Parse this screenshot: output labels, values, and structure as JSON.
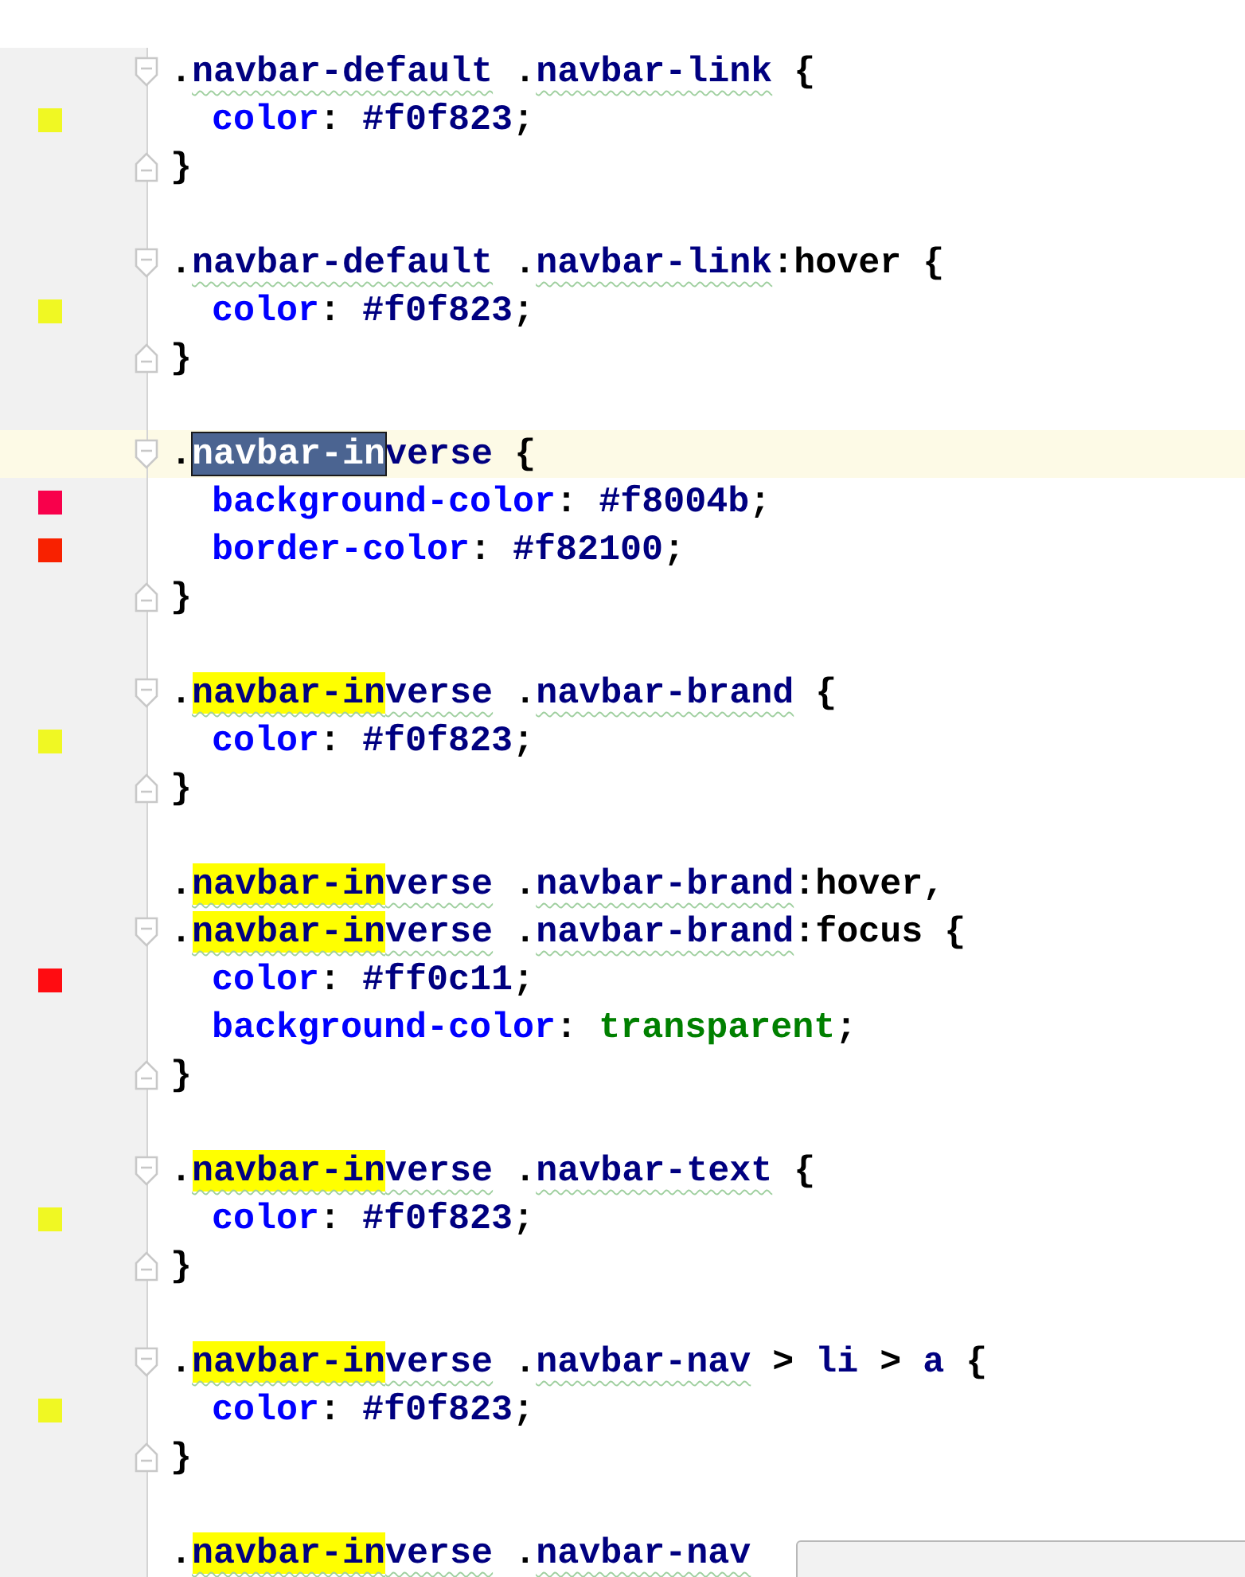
{
  "editor": {
    "lines": [
      {
        "current": false,
        "kind": "open",
        "tokens": [
          {
            "text": ".",
            "kind": "punct"
          },
          {
            "text": "navbar-default",
            "kind": "selector",
            "underlined": true
          },
          {
            "text": " .",
            "kind": "punct"
          },
          {
            "text": "navbar-link",
            "kind": "selector",
            "underlined": true
          },
          {
            "text": " {",
            "kind": "punct"
          }
        ]
      },
      {
        "current": false,
        "kind": "body",
        "color": "#f0f823",
        "indent": true,
        "tokens": [
          {
            "text": "color",
            "kind": "property"
          },
          {
            "text": ": ",
            "kind": "punct"
          },
          {
            "text": "#f0f823",
            "kind": "value"
          },
          {
            "text": ";",
            "kind": "punct"
          }
        ]
      },
      {
        "current": false,
        "kind": "close",
        "tokens": [
          {
            "text": "}",
            "kind": "punct"
          }
        ]
      },
      {
        "current": false,
        "kind": "blank"
      },
      {
        "current": false,
        "kind": "open",
        "tokens": [
          {
            "text": ".",
            "kind": "punct"
          },
          {
            "text": "navbar-default",
            "kind": "selector",
            "underlined": true
          },
          {
            "text": " .",
            "kind": "punct"
          },
          {
            "text": "navbar-link",
            "kind": "selector",
            "underlined": true
          },
          {
            "text": ":hover {",
            "kind": "punct"
          }
        ]
      },
      {
        "current": false,
        "kind": "body",
        "color": "#f0f823",
        "indent": true,
        "tokens": [
          {
            "text": "color",
            "kind": "property"
          },
          {
            "text": ": ",
            "kind": "punct"
          },
          {
            "text": "#f0f823",
            "kind": "value"
          },
          {
            "text": ";",
            "kind": "punct"
          }
        ]
      },
      {
        "current": false,
        "kind": "close",
        "tokens": [
          {
            "text": "}",
            "kind": "punct"
          }
        ]
      },
      {
        "current": false,
        "kind": "blank"
      },
      {
        "current": true,
        "kind": "open",
        "tokens": [
          {
            "text": ".",
            "kind": "punct"
          },
          {
            "text": "navbar-in",
            "kind": "selection"
          },
          {
            "text": "verse",
            "kind": "selector"
          },
          {
            "text": " {",
            "kind": "punct"
          }
        ]
      },
      {
        "current": false,
        "kind": "body",
        "color": "#f8004b",
        "indent": true,
        "tokens": [
          {
            "text": "background-color",
            "kind": "property"
          },
          {
            "text": ": ",
            "kind": "punct"
          },
          {
            "text": "#f8004b",
            "kind": "value"
          },
          {
            "text": ";",
            "kind": "punct"
          }
        ]
      },
      {
        "current": false,
        "kind": "body",
        "color": "#f82100",
        "indent": true,
        "tokens": [
          {
            "text": "border-color",
            "kind": "property"
          },
          {
            "text": ": ",
            "kind": "punct"
          },
          {
            "text": "#f82100",
            "kind": "value"
          },
          {
            "text": ";",
            "kind": "punct"
          }
        ]
      },
      {
        "current": false,
        "kind": "close",
        "tokens": [
          {
            "text": "}",
            "kind": "punct"
          }
        ]
      },
      {
        "current": false,
        "kind": "blank"
      },
      {
        "current": false,
        "kind": "open",
        "tokens": [
          {
            "text": ".",
            "kind": "punct"
          },
          {
            "text": "navbar-in",
            "kind": "match",
            "underlined": true
          },
          {
            "text": "verse",
            "kind": "selector",
            "underlined": true
          },
          {
            "text": " .",
            "kind": "punct"
          },
          {
            "text": "navbar-brand",
            "kind": "selector",
            "underlined": true
          },
          {
            "text": " {",
            "kind": "punct"
          }
        ]
      },
      {
        "current": false,
        "kind": "body",
        "color": "#f0f823",
        "indent": true,
        "tokens": [
          {
            "text": "color",
            "kind": "property"
          },
          {
            "text": ": ",
            "kind": "punct"
          },
          {
            "text": "#f0f823",
            "kind": "value"
          },
          {
            "text": ";",
            "kind": "punct"
          }
        ]
      },
      {
        "current": false,
        "kind": "close",
        "tokens": [
          {
            "text": "}",
            "kind": "punct"
          }
        ]
      },
      {
        "current": false,
        "kind": "blank"
      },
      {
        "current": false,
        "kind": "plain",
        "tokens": [
          {
            "text": ".",
            "kind": "punct"
          },
          {
            "text": "navbar-in",
            "kind": "match",
            "underlined": true
          },
          {
            "text": "verse",
            "kind": "selector",
            "underlined": true
          },
          {
            "text": " .",
            "kind": "punct"
          },
          {
            "text": "navbar-brand",
            "kind": "selector",
            "underlined": true
          },
          {
            "text": ":hover,",
            "kind": "punct"
          }
        ]
      },
      {
        "current": false,
        "kind": "open",
        "tokens": [
          {
            "text": ".",
            "kind": "punct"
          },
          {
            "text": "navbar-in",
            "kind": "match",
            "underlined": true
          },
          {
            "text": "verse",
            "kind": "selector",
            "underlined": true
          },
          {
            "text": " .",
            "kind": "punct"
          },
          {
            "text": "navbar-brand",
            "kind": "selector",
            "underlined": true
          },
          {
            "text": ":focus {",
            "kind": "punct"
          }
        ]
      },
      {
        "current": false,
        "kind": "body",
        "color": "#ff0c11",
        "indent": true,
        "tokens": [
          {
            "text": "color",
            "kind": "property"
          },
          {
            "text": ": ",
            "kind": "punct"
          },
          {
            "text": "#ff0c11",
            "kind": "value"
          },
          {
            "text": ";",
            "kind": "punct"
          }
        ]
      },
      {
        "current": false,
        "kind": "body",
        "indent": true,
        "tokens": [
          {
            "text": "background-color",
            "kind": "property"
          },
          {
            "text": ": ",
            "kind": "punct"
          },
          {
            "text": "transparent",
            "kind": "keyword"
          },
          {
            "text": ";",
            "kind": "punct"
          }
        ]
      },
      {
        "current": false,
        "kind": "close",
        "tokens": [
          {
            "text": "}",
            "kind": "punct"
          }
        ]
      },
      {
        "current": false,
        "kind": "blank"
      },
      {
        "current": false,
        "kind": "open",
        "tokens": [
          {
            "text": ".",
            "kind": "punct"
          },
          {
            "text": "navbar-in",
            "kind": "match",
            "underlined": true
          },
          {
            "text": "verse",
            "kind": "selector",
            "underlined": true
          },
          {
            "text": " .",
            "kind": "punct"
          },
          {
            "text": "navbar-text",
            "kind": "selector",
            "underlined": true
          },
          {
            "text": " {",
            "kind": "punct"
          }
        ]
      },
      {
        "current": false,
        "kind": "body",
        "color": "#f0f823",
        "indent": true,
        "tokens": [
          {
            "text": "color",
            "kind": "property"
          },
          {
            "text": ": ",
            "kind": "punct"
          },
          {
            "text": "#f0f823",
            "kind": "value"
          },
          {
            "text": ";",
            "kind": "punct"
          }
        ]
      },
      {
        "current": false,
        "kind": "close",
        "tokens": [
          {
            "text": "}",
            "kind": "punct"
          }
        ]
      },
      {
        "current": false,
        "kind": "blank"
      },
      {
        "current": false,
        "kind": "open",
        "tokens": [
          {
            "text": ".",
            "kind": "punct"
          },
          {
            "text": "navbar-in",
            "kind": "match",
            "underlined": true
          },
          {
            "text": "verse",
            "kind": "selector",
            "underlined": true
          },
          {
            "text": " .",
            "kind": "punct"
          },
          {
            "text": "navbar-nav",
            "kind": "selector",
            "underlined": true
          },
          {
            "text": " > ",
            "kind": "punct"
          },
          {
            "text": "li",
            "kind": "selector"
          },
          {
            "text": " > ",
            "kind": "punct"
          },
          {
            "text": "a",
            "kind": "selector"
          },
          {
            "text": " {",
            "kind": "punct"
          }
        ]
      },
      {
        "current": false,
        "kind": "body",
        "color": "#f0f823",
        "indent": true,
        "tokens": [
          {
            "text": "color",
            "kind": "property"
          },
          {
            "text": ": ",
            "kind": "punct"
          },
          {
            "text": "#f0f823",
            "kind": "value"
          },
          {
            "text": ";",
            "kind": "punct"
          }
        ]
      },
      {
        "current": false,
        "kind": "close",
        "tokens": [
          {
            "text": "}",
            "kind": "punct"
          }
        ]
      },
      {
        "current": false,
        "kind": "blank"
      },
      {
        "current": false,
        "kind": "plain",
        "tokens": [
          {
            "text": ".",
            "kind": "punct"
          },
          {
            "text": "navbar-in",
            "kind": "match",
            "underlined": true
          },
          {
            "text": "verse",
            "kind": "selector",
            "underlined": true
          },
          {
            "text": " .",
            "kind": "punct"
          },
          {
            "text": "navbar-nav",
            "kind": "selector",
            "underlined": true
          }
        ]
      }
    ]
  }
}
